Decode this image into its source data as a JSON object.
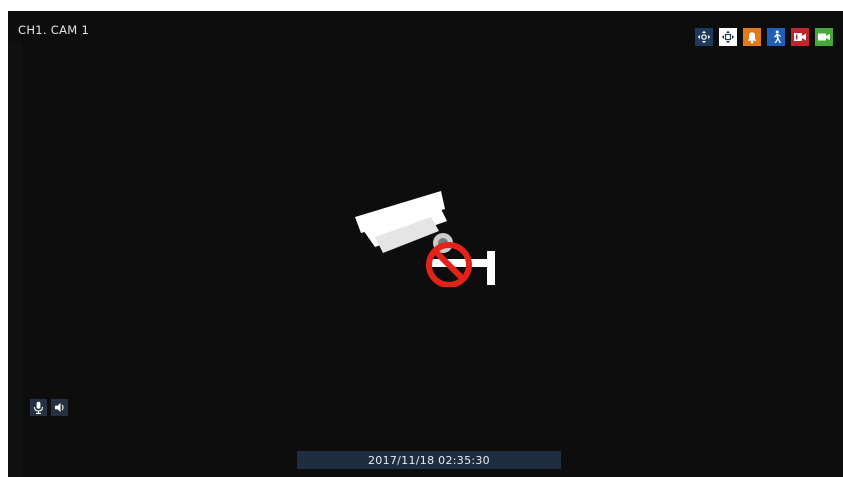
{
  "channel": {
    "label": "CH1. CAM 1"
  },
  "status_icons": [
    {
      "name": "ptz-icon",
      "color": "#1f3a5c"
    },
    {
      "name": "digital-ptz-icon",
      "color": "#ffffff"
    },
    {
      "name": "alarm-bell-icon",
      "color": "#e07a1a"
    },
    {
      "name": "motion-person-icon",
      "color": "#1f5fb8"
    },
    {
      "name": "recording-icon",
      "color": "#c0252a"
    },
    {
      "name": "camera-video-icon",
      "color": "#46a83a"
    }
  ],
  "video": {
    "state_icon": "no-camera-icon"
  },
  "audio_controls": [
    {
      "name": "microphone-icon"
    },
    {
      "name": "speaker-icon"
    }
  ],
  "timestamp": {
    "text": "2017/11/18 02:35:30"
  }
}
